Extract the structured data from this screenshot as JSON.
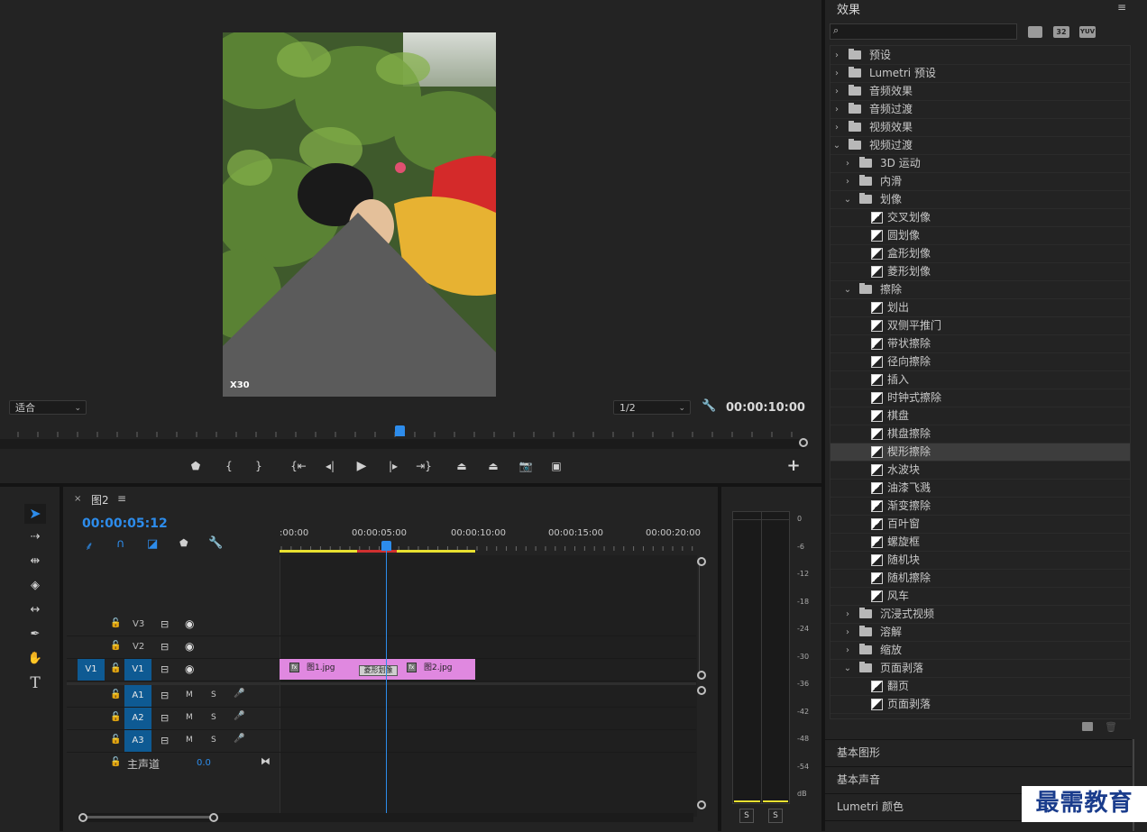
{
  "monitor": {
    "zoom_label": "适合",
    "resolution_label": "1/2",
    "duration_timecode": "00:00:10:00",
    "watermark": "X30"
  },
  "playback_controls": [
    {
      "name": "marker-button",
      "glyph": "⬟"
    },
    {
      "name": "mark-in-button",
      "glyph": "{"
    },
    {
      "name": "mark-out-button",
      "glyph": "}"
    },
    {
      "name": "go-to-in-button",
      "glyph": "{⇤"
    },
    {
      "name": "step-back-button",
      "glyph": "◂|"
    },
    {
      "name": "play-button",
      "glyph": "▶"
    },
    {
      "name": "step-forward-button",
      "glyph": "|▸"
    },
    {
      "name": "go-to-out-button",
      "glyph": "⇥}"
    },
    {
      "name": "lift-button",
      "glyph": "⏏"
    },
    {
      "name": "extract-button",
      "glyph": "⏏"
    },
    {
      "name": "export-frame-button",
      "glyph": "📷"
    },
    {
      "name": "comparison-view-button",
      "glyph": "▣"
    }
  ],
  "timeline": {
    "sequence_name": "图2",
    "current_timecode": "00:00:05:12",
    "ruler_labels": [
      ":00:00",
      "00:00:05:00",
      "00:00:10:00",
      "00:00:15:00",
      "00:00:20:00"
    ],
    "video_tracks": [
      {
        "label": "V3"
      },
      {
        "label": "V2"
      },
      {
        "label": "V1",
        "source": "V1"
      }
    ],
    "audio_tracks": [
      {
        "label": "A1",
        "m": "M",
        "s": "S"
      },
      {
        "label": "A2",
        "m": "M",
        "s": "S"
      },
      {
        "label": "A3",
        "m": "M",
        "s": "S"
      }
    ],
    "master": {
      "label": "主声道",
      "value": "0.0"
    },
    "clips": [
      {
        "name": "图1.jpg",
        "fx": "fx"
      },
      {
        "name": "图2.jpg",
        "fx": "fx"
      }
    ],
    "transition_label": "菱形划像"
  },
  "meters": {
    "scale": [
      "0",
      "-6",
      "-12",
      "-18",
      "-24",
      "-30",
      "-36",
      "-42",
      "-48",
      "-54",
      "dB"
    ],
    "solo_left": "S",
    "solo_right": "S"
  },
  "effects": {
    "title": "效果",
    "search_placeholder": "",
    "filter_badges": [
      "32",
      "YUV"
    ],
    "tree": [
      {
        "label": "预设",
        "level": 0,
        "kind": "folder",
        "open": false
      },
      {
        "label": "Lumetri 预设",
        "level": 0,
        "kind": "folder",
        "open": false
      },
      {
        "label": "音频效果",
        "level": 0,
        "kind": "folder",
        "open": false
      },
      {
        "label": "音频过渡",
        "level": 0,
        "kind": "folder",
        "open": false
      },
      {
        "label": "视频效果",
        "level": 0,
        "kind": "folder",
        "open": false
      },
      {
        "label": "视频过渡",
        "level": 0,
        "kind": "folder",
        "open": true
      },
      {
        "label": "3D 运动",
        "level": 1,
        "kind": "folder",
        "open": false
      },
      {
        "label": "内滑",
        "level": 1,
        "kind": "folder",
        "open": false
      },
      {
        "label": "划像",
        "level": 1,
        "kind": "folder",
        "open": true
      },
      {
        "label": "交叉划像",
        "level": 2,
        "kind": "fx"
      },
      {
        "label": "圆划像",
        "level": 2,
        "kind": "fx"
      },
      {
        "label": "盒形划像",
        "level": 2,
        "kind": "fx"
      },
      {
        "label": "菱形划像",
        "level": 2,
        "kind": "fx"
      },
      {
        "label": "擦除",
        "level": 1,
        "kind": "folder",
        "open": true
      },
      {
        "label": "划出",
        "level": 2,
        "kind": "fx"
      },
      {
        "label": "双侧平推门",
        "level": 2,
        "kind": "fx"
      },
      {
        "label": "带状擦除",
        "level": 2,
        "kind": "fx"
      },
      {
        "label": "径向擦除",
        "level": 2,
        "kind": "fx"
      },
      {
        "label": "插入",
        "level": 2,
        "kind": "fx"
      },
      {
        "label": "时钟式擦除",
        "level": 2,
        "kind": "fx"
      },
      {
        "label": "棋盘",
        "level": 2,
        "kind": "fx"
      },
      {
        "label": "棋盘擦除",
        "level": 2,
        "kind": "fx"
      },
      {
        "label": "楔形擦除",
        "level": 2,
        "kind": "fx",
        "selected": true
      },
      {
        "label": "水波块",
        "level": 2,
        "kind": "fx"
      },
      {
        "label": "油漆飞溅",
        "level": 2,
        "kind": "fx"
      },
      {
        "label": "渐变擦除",
        "level": 2,
        "kind": "fx"
      },
      {
        "label": "百叶窗",
        "level": 2,
        "kind": "fx"
      },
      {
        "label": "螺旋框",
        "level": 2,
        "kind": "fx"
      },
      {
        "label": "随机块",
        "level": 2,
        "kind": "fx"
      },
      {
        "label": "随机擦除",
        "level": 2,
        "kind": "fx"
      },
      {
        "label": "风车",
        "level": 2,
        "kind": "fx"
      },
      {
        "label": "沉浸式视频",
        "level": 1,
        "kind": "folder",
        "open": false
      },
      {
        "label": "溶解",
        "level": 1,
        "kind": "folder",
        "open": false
      },
      {
        "label": "缩放",
        "level": 1,
        "kind": "folder",
        "open": false
      },
      {
        "label": "页面剥落",
        "level": 1,
        "kind": "folder",
        "open": true
      },
      {
        "label": "翻页",
        "level": 2,
        "kind": "fx"
      },
      {
        "label": "页面剥落",
        "level": 2,
        "kind": "fx"
      }
    ],
    "sections": [
      "基本图形",
      "基本声音",
      "Lumetri 颜色"
    ],
    "bottom_watermark": "最需教育"
  },
  "colors": {
    "accent_blue": "#2d8ceb",
    "clip_pink": "#e088e0",
    "work_area_yellow": "#e8e030",
    "render_red": "#d03030"
  }
}
